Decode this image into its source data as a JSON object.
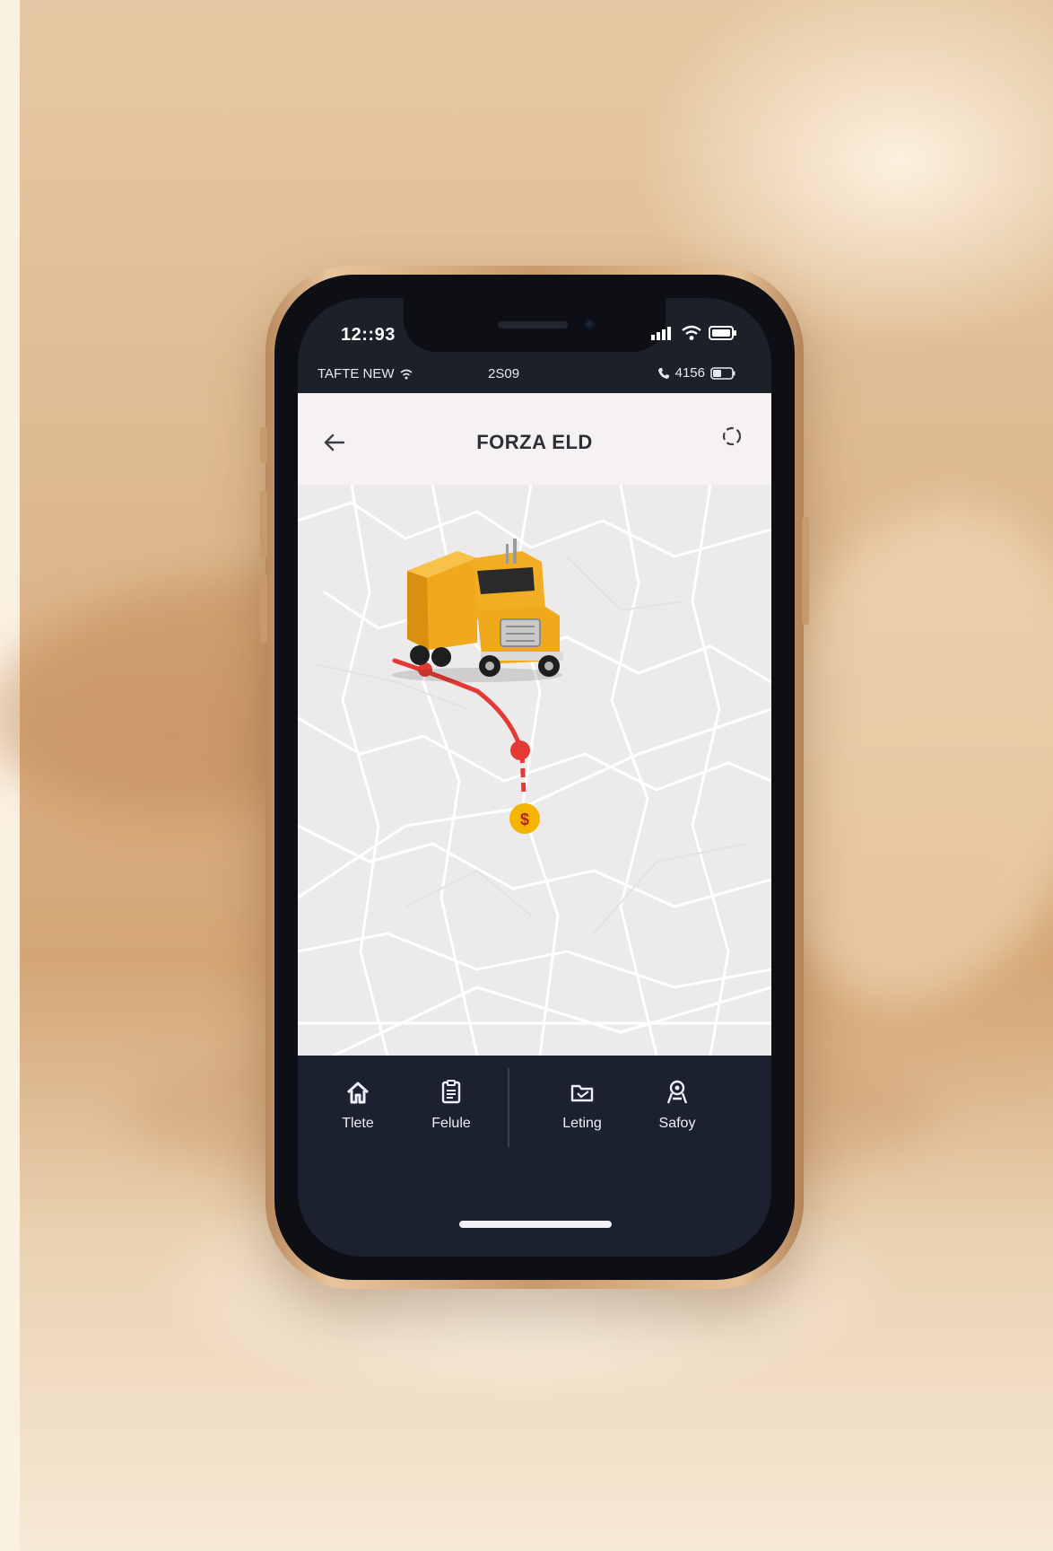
{
  "status_bar": {
    "time": "12::93",
    "carrier": "TAFTE NEW",
    "center": "2S09",
    "battery_text": "4156"
  },
  "app_bar": {
    "title": "FORZA ELD"
  },
  "map": {
    "vehicle": "truck",
    "marker_label": "$",
    "route_color": "#e53935",
    "marker_color": "#f4b400"
  },
  "tabs": [
    {
      "label": "Tlete",
      "icon": "home-icon"
    },
    {
      "label": "Felule",
      "icon": "document-icon"
    },
    {
      "label": "Leting",
      "icon": "folder-icon"
    },
    {
      "label": "Safoy",
      "icon": "safety-icon"
    }
  ],
  "colors": {
    "accent": "#f4b400",
    "route": "#e53935",
    "nav_background": "#1c2130",
    "frame": "#d9ad80"
  }
}
